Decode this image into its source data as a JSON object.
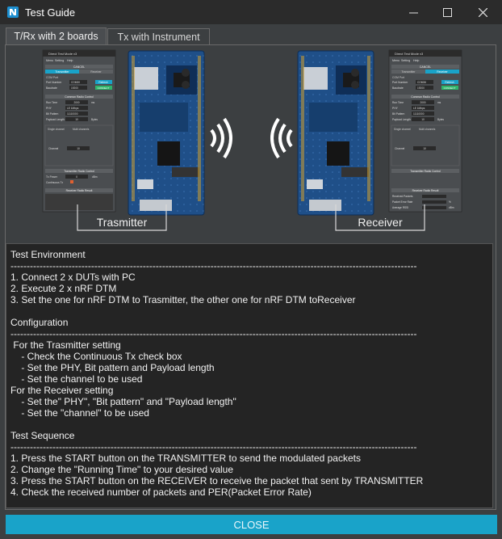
{
  "window": {
    "title": "Test Guide",
    "minimize_icon": "minimize-icon",
    "maximize_icon": "maximize-icon",
    "close_icon": "close-icon"
  },
  "tabs": [
    {
      "label": "T/Rx with 2 boards",
      "active": true
    },
    {
      "label": "Tx with Instrument",
      "active": false
    }
  ],
  "diagram": {
    "transmitter_label": "Trasmitter",
    "receiver_label": "Receiver",
    "mini_app_tx": {
      "title": "Direct Test Mode v3",
      "menu": [
        "Menu",
        "Setting",
        "Help"
      ],
      "cancel": "CANCEL",
      "mode_tabs": [
        "Transmitter",
        "Receiver"
      ],
      "com_port_title": "COM Port",
      "port_label": "Port Number",
      "port_value": "COM30",
      "refresh": "Refresh",
      "baud_label": "Baudrate",
      "baud_value": "19200",
      "connect": "CONNECT",
      "common_title": "Common Radio Control",
      "run_time_label": "Run Time",
      "run_time_value": "2000",
      "run_time_unit": "ms",
      "phy_label": "PHY",
      "phy_value": "LE 1Mbps",
      "bit_label": "Bit Pattern",
      "bit_value": "11110000",
      "payload_label": "Payload Length",
      "payload_value": "10",
      "payload_unit": "Bytes",
      "channel_tabs": [
        "Single channel",
        "Multi channels"
      ],
      "channel_label": "Channel",
      "channel_value": "10",
      "tx_title": "Transmitter Radio Control",
      "tx_power_label": "Tx Power",
      "tx_power_value": "0",
      "tx_power_unit": "dBm",
      "cont_tx_label": "Continuous Tx",
      "rx_title": "Receiver Radio Result"
    },
    "mini_app_rx": {
      "title": "Direct Test Mode v3",
      "menu": [
        "Menu",
        "Setting",
        "Help"
      ],
      "cancel": "CANCEL",
      "mode_tabs": [
        "Transmitter",
        "Receiver"
      ],
      "com_port_title": "COM Port",
      "port_label": "Port Number",
      "port_value": "COM36",
      "refresh": "Refresh",
      "baud_label": "Baudrate",
      "baud_value": "19200",
      "connect": "CONNECT",
      "common_title": "Common Radio Control",
      "run_time_label": "Run Time",
      "run_time_value": "2000",
      "run_time_unit": "ms",
      "phy_label": "PHY",
      "phy_value": "LE 1Mbps",
      "bit_label": "Bit Pattern",
      "bit_value": "11110000",
      "payload_label": "Payload Length",
      "payload_value": "10",
      "payload_unit": "Bytes",
      "channel_tabs": [
        "Single channel",
        "Multi channels"
      ],
      "channel_label": "Channel",
      "channel_value": "10",
      "tx_title": "Transmitter Radio Control",
      "rx_title": "Receiver Radio Result",
      "received_label": "Received Packets",
      "per_label": "Packet Error Rate",
      "per_unit": "%",
      "rssi_label": "Average RSSI",
      "rssi_unit": "dBm"
    }
  },
  "guide_text": "Test Environment\n------------------------------------------------------------------------------------------------------------------------------\n1. Connect 2 x DUTs with PC\n2. Execute 2 x nRF DTM\n3. Set the one for nRF DTM to Trasmitter, the other one for nRF DTM toReceiver\n\nConfiguration\n------------------------------------------------------------------------------------------------------------------------------\n For the Trasmitter setting\n    - Check the Continuous Tx check box\n    - Set the PHY, Bit pattern and Payload length\n    - Set the channel to be used\nFor the Receiver setting\n    - Set the\" PHY\", \"Bit pattern\" and \"Payload length\"\n    - Set the \"channel\" to be used\n\nTest Sequence\n------------------------------------------------------------------------------------------------------------------------------\n1. Press the START button on the TRANSMITTER to send the modulated packets\n2. Change the \"Running Time\" to your desired value\n3. Press the START button on the RECEIVER to receive the packet that sent by TRANSMITTER\n4. Check the received number of packets and PER(Packet Error Rate)",
  "close_button": "CLOSE",
  "colors": {
    "accent": "#19a3c9",
    "board": "#1e4f86",
    "background": "#3c3f41"
  }
}
